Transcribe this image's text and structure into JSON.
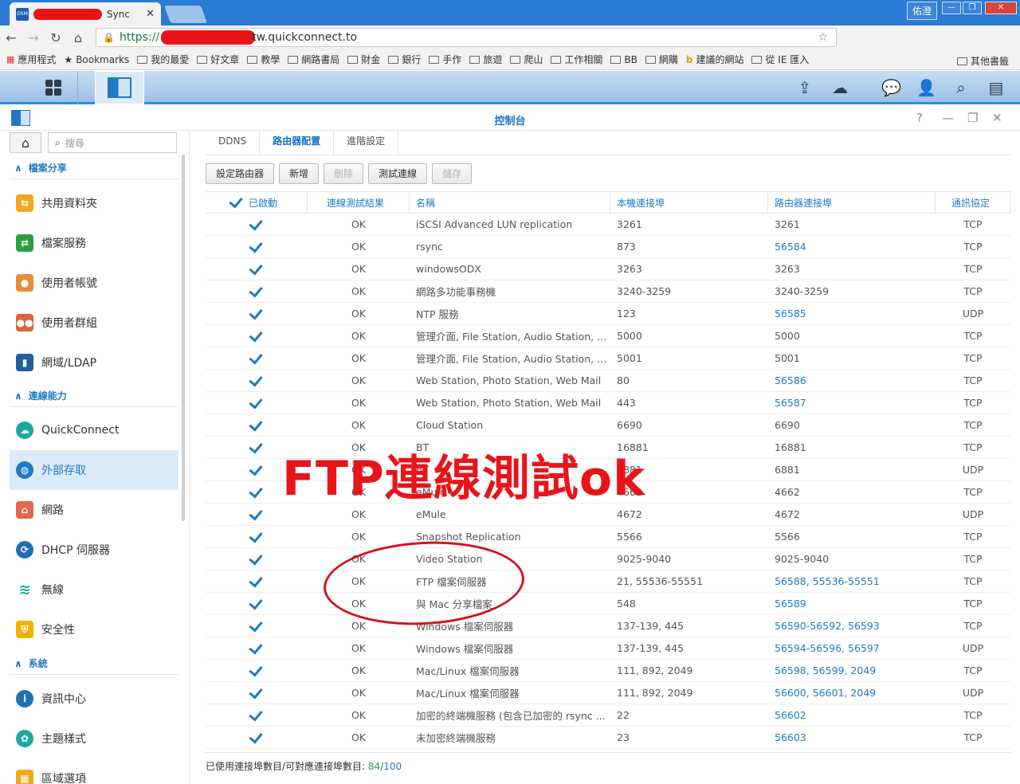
{
  "browser": {
    "tab_title": "Sync",
    "tab_favicon_text": "DSM",
    "url_scheme": "https://",
    "url_host": "tw.quickconnect.to",
    "window_user": "佑澄",
    "bookmarks": [
      "應用程式",
      "Bookmarks",
      "我的最愛",
      "好文章",
      "教學",
      "網路書局",
      "財金",
      "銀行",
      "手作",
      "旅遊",
      "爬山",
      "工作相關",
      "BB",
      "網購",
      "建議的網站",
      "從 IE 匯入"
    ],
    "other_bookmarks": "其他書籤"
  },
  "app": {
    "title": "控制台"
  },
  "sidebar": {
    "search_placeholder": "搜尋",
    "sections": [
      {
        "label": "檔案分享",
        "items": [
          "共用資料夾",
          "檔案服務",
          "使用者帳號",
          "使用者群組",
          "網域/LDAP"
        ]
      },
      {
        "label": "連線能力",
        "items": [
          "QuickConnect",
          "外部存取",
          "網路",
          "DHCP 伺服器",
          "無線",
          "安全性"
        ]
      },
      {
        "label": "系統",
        "items": [
          "資訊中心",
          "主題樣式",
          "區域選項"
        ]
      }
    ],
    "selected": "外部存取"
  },
  "tabs": [
    "DDNS",
    "路由器配置",
    "進階設定"
  ],
  "active_tab": "路由器配置",
  "toolbar": {
    "setup_router": "設定路由器",
    "add": "新增",
    "delete": "刪除",
    "test": "測試連線",
    "save": "儲存"
  },
  "table": {
    "headers": [
      "已啟動",
      "連線測試結果",
      "名稱",
      "本機連接埠",
      "路由器連接埠",
      "通訊協定"
    ],
    "rows": [
      {
        "result": "OK",
        "name": "iSCSI Advanced LUN replication",
        "local": "3261",
        "router": "3261",
        "router_link": false,
        "proto": "TCP"
      },
      {
        "result": "OK",
        "name": "rsync",
        "local": "873",
        "router": "56584",
        "router_link": true,
        "proto": "TCP"
      },
      {
        "result": "OK",
        "name": "windowsODX",
        "local": "3263",
        "router": "3263",
        "router_link": false,
        "proto": "TCP"
      },
      {
        "result": "OK",
        "name": "網路多功能事務機",
        "local": "3240-3259",
        "router": "3240-3259",
        "router_link": false,
        "proto": "TCP"
      },
      {
        "result": "OK",
        "name": "NTP 服務",
        "local": "123",
        "router": "56585",
        "router_link": true,
        "proto": "UDP"
      },
      {
        "result": "OK",
        "name": "管理介面, File Station, Audio Station, S...",
        "local": "5000",
        "router": "5000",
        "router_link": false,
        "proto": "TCP"
      },
      {
        "result": "OK",
        "name": "管理介面, File Station, Audio Station, S...",
        "local": "5001",
        "router": "5001",
        "router_link": false,
        "proto": "TCP"
      },
      {
        "result": "OK",
        "name": "Web Station, Photo Station, Web Mail",
        "local": "80",
        "router": "56586",
        "router_link": true,
        "proto": "TCP"
      },
      {
        "result": "OK",
        "name": "Web Station, Photo Station, Web Mail",
        "local": "443",
        "router": "56587",
        "router_link": true,
        "proto": "TCP"
      },
      {
        "result": "OK",
        "name": "Cloud Station",
        "local": "6690",
        "router": "6690",
        "router_link": false,
        "proto": "TCP"
      },
      {
        "result": "OK",
        "name": "BT",
        "local": "16881",
        "router": "16881",
        "router_link": false,
        "proto": "TCP"
      },
      {
        "result": "OK",
        "name": "BT",
        "local": "6881",
        "router": "6881",
        "router_link": false,
        "proto": "UDP"
      },
      {
        "result": "OK",
        "name": "eMule",
        "local": "4662",
        "router": "4662",
        "router_link": false,
        "proto": "TCP"
      },
      {
        "result": "OK",
        "name": "eMule",
        "local": "4672",
        "router": "4672",
        "router_link": false,
        "proto": "UDP"
      },
      {
        "result": "OK",
        "name": "Snapshot Replication",
        "local": "5566",
        "router": "5566",
        "router_link": false,
        "proto": "TCP"
      },
      {
        "result": "OK",
        "name": "Video Station",
        "local": "9025-9040",
        "router": "9025-9040",
        "router_link": false,
        "proto": "TCP"
      },
      {
        "result": "OK",
        "name": "FTP 檔案伺服器",
        "local": "21, 55536-55551",
        "router": "56588, 55536-55551",
        "router_link": true,
        "proto": "TCP"
      },
      {
        "result": "OK",
        "name": "與 Mac 分享檔案",
        "local": "548",
        "router": "56589",
        "router_link": true,
        "proto": "TCP"
      },
      {
        "result": "OK",
        "name": "Windows 檔案伺服器",
        "local": "137-139, 445",
        "router": "56590-56592, 56593",
        "router_link": true,
        "proto": "TCP"
      },
      {
        "result": "OK",
        "name": "Windows 檔案伺服器",
        "local": "137-139, 445",
        "router": "56594-56596, 56597",
        "router_link": true,
        "proto": "UDP"
      },
      {
        "result": "OK",
        "name": "Mac/Linux 檔案伺服器",
        "local": "111, 892, 2049",
        "router": "56598, 56599, 2049",
        "router_link": true,
        "proto": "TCP"
      },
      {
        "result": "OK",
        "name": "Mac/Linux 檔案伺服器",
        "local": "111, 892, 2049",
        "router": "56600, 56601, 2049",
        "router_link": true,
        "proto": "UDP"
      },
      {
        "result": "OK",
        "name": "加密的終端機服務 (包含已加密的 rsync ...",
        "local": "22",
        "router": "56602",
        "router_link": true,
        "proto": "TCP"
      },
      {
        "result": "OK",
        "name": "未加密終端機服務",
        "local": "23",
        "router": "56603",
        "router_link": true,
        "proto": "TCP"
      }
    ]
  },
  "status": {
    "label": "已使用連接埠數目/可對應連接埠數目:",
    "used": "84",
    "separator": "/",
    "total": "100"
  },
  "annotation": {
    "text": "FTP連線測試ok"
  },
  "colors": {
    "accent": "#1f7ac4",
    "annotation_red": "#e8141a",
    "used_green": "#2ca02c"
  }
}
